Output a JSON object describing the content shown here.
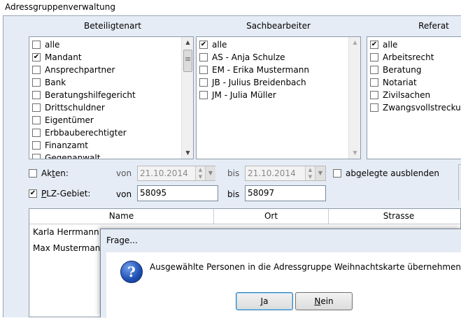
{
  "window": {
    "title": "Adressgruppenverwaltung"
  },
  "columns": {
    "beteiligtenart": {
      "header": "Beteiligtenart",
      "items": [
        {
          "label": "alle",
          "checked": false
        },
        {
          "label": "Mandant",
          "checked": true
        },
        {
          "label": "Ansprechpartner",
          "checked": false
        },
        {
          "label": "Bank",
          "checked": false
        },
        {
          "label": "Beratungshilfegericht",
          "checked": false
        },
        {
          "label": "Drittschuldner",
          "checked": false
        },
        {
          "label": "Eigentümer",
          "checked": false
        },
        {
          "label": "Erbbauberechtigter",
          "checked": false
        },
        {
          "label": "Finanzamt",
          "checked": false
        },
        {
          "label": "Gegenanwalt",
          "checked": false
        }
      ]
    },
    "sachbearbeiter": {
      "header": "Sachbearbeiter",
      "items": [
        {
          "label": "alle",
          "checked": true
        },
        {
          "label": "AS - Anja Schulze",
          "checked": false
        },
        {
          "label": "EM - Erika Mustermann",
          "checked": false
        },
        {
          "label": "JB - Julius Breidenbach",
          "checked": false
        },
        {
          "label": "JM - Julia Müller",
          "checked": false
        }
      ]
    },
    "referat": {
      "header": "Referat",
      "items": [
        {
          "label": "alle",
          "checked": true
        },
        {
          "label": "Arbeitsrecht",
          "checked": false
        },
        {
          "label": "Beratung",
          "checked": false
        },
        {
          "label": "Notariat",
          "checked": false
        },
        {
          "label": "Zivilsachen",
          "checked": false
        },
        {
          "label": "Zwangsvollstrecku",
          "checked": false
        }
      ]
    }
  },
  "filters": {
    "akten": {
      "label_pre": "Ak",
      "label_u": "t",
      "label_post": "en:",
      "checked": false,
      "von_label": "von",
      "von_value": "21.10.2014",
      "bis_label": "bis",
      "bis_value": "21.10.2014"
    },
    "plz": {
      "label_u": "P",
      "label_post": "LZ-Gebiet:",
      "checked": true,
      "von_label": "von",
      "von_value": "58095",
      "bis_label": "bis",
      "bis_value": "58097"
    },
    "abgelegte": {
      "label_pre": "ab",
      "label_u": "g",
      "label_post": "elegte ausblenden",
      "checked": false
    }
  },
  "grid": {
    "headers": [
      "Name",
      "Ort",
      "Strasse"
    ],
    "rows": [
      {
        "name": "Karla Herrmann"
      },
      {
        "name": "Max Mustermann"
      }
    ]
  },
  "dialog": {
    "title": "Frage...",
    "message": "Ausgewählte Personen in die Adressgruppe Weihnachtskarte übernehmen?",
    "yes_u": "J",
    "yes_post": "a",
    "no_u": "N",
    "no_post": "ein",
    "icon": "question-icon"
  }
}
